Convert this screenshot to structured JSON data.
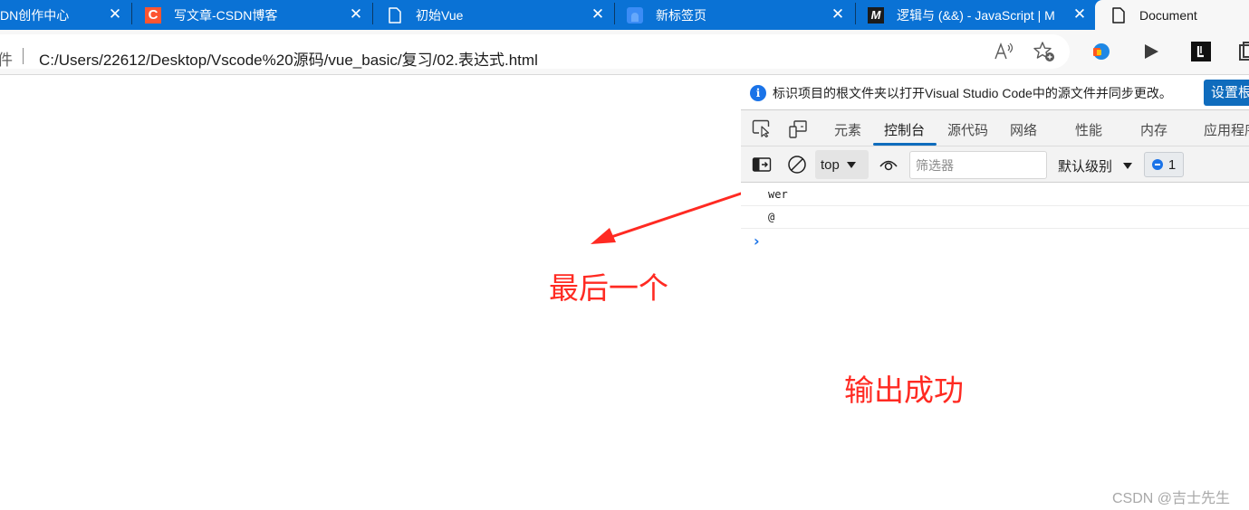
{
  "browser": {
    "tabs": [
      {
        "title": "DN创作中心",
        "icon": "csdn-creator-icon",
        "active": false
      },
      {
        "title": "写文章-CSDN博客",
        "icon": "csdn-icon",
        "icon_glyph": "C",
        "active": false
      },
      {
        "title": "初始Vue",
        "icon": "page-icon",
        "active": false
      },
      {
        "title": "新标签页",
        "icon": "new-tab-icon",
        "active": false
      },
      {
        "title": "逻辑与 (&&) - JavaScript | M",
        "icon": "mdn-icon",
        "icon_glyph": "M",
        "active": false
      },
      {
        "title": "Document",
        "icon": "page-icon",
        "active": true
      }
    ],
    "address_bar": {
      "scheme_label": "文件",
      "url": "C:/Users/22612/Desktop/Vscode%20源码/vue_basic/复习/02.表达式.html"
    },
    "toolbar_icons": [
      "read-aloud-icon",
      "add-favorite-icon",
      "extension-translate-icon",
      "extension-play-icon",
      "extension-l-icon",
      "collections-icon"
    ]
  },
  "devtools": {
    "infobar": {
      "text": "标识项目的根文件夹以打开Visual Studio Code中的源文件并同步更改。",
      "button_label": "设置根"
    },
    "tabs": [
      "元素",
      "控制台",
      "源代码",
      "网络",
      "性能",
      "内存",
      "应用程序"
    ],
    "active_tab": "控制台",
    "console_toolbar": {
      "context": "top",
      "filter_placeholder": "筛选器",
      "filter_value": "",
      "levels_label": "默认级别",
      "issues_count": "1"
    },
    "console_messages": [
      "wer",
      "@"
    ],
    "prompt_glyph": "›"
  },
  "annotations": {
    "label_last": "最后一个",
    "label_success": "输出成功",
    "color": "#ff2a22"
  },
  "watermark": "CSDN @吉士先生"
}
